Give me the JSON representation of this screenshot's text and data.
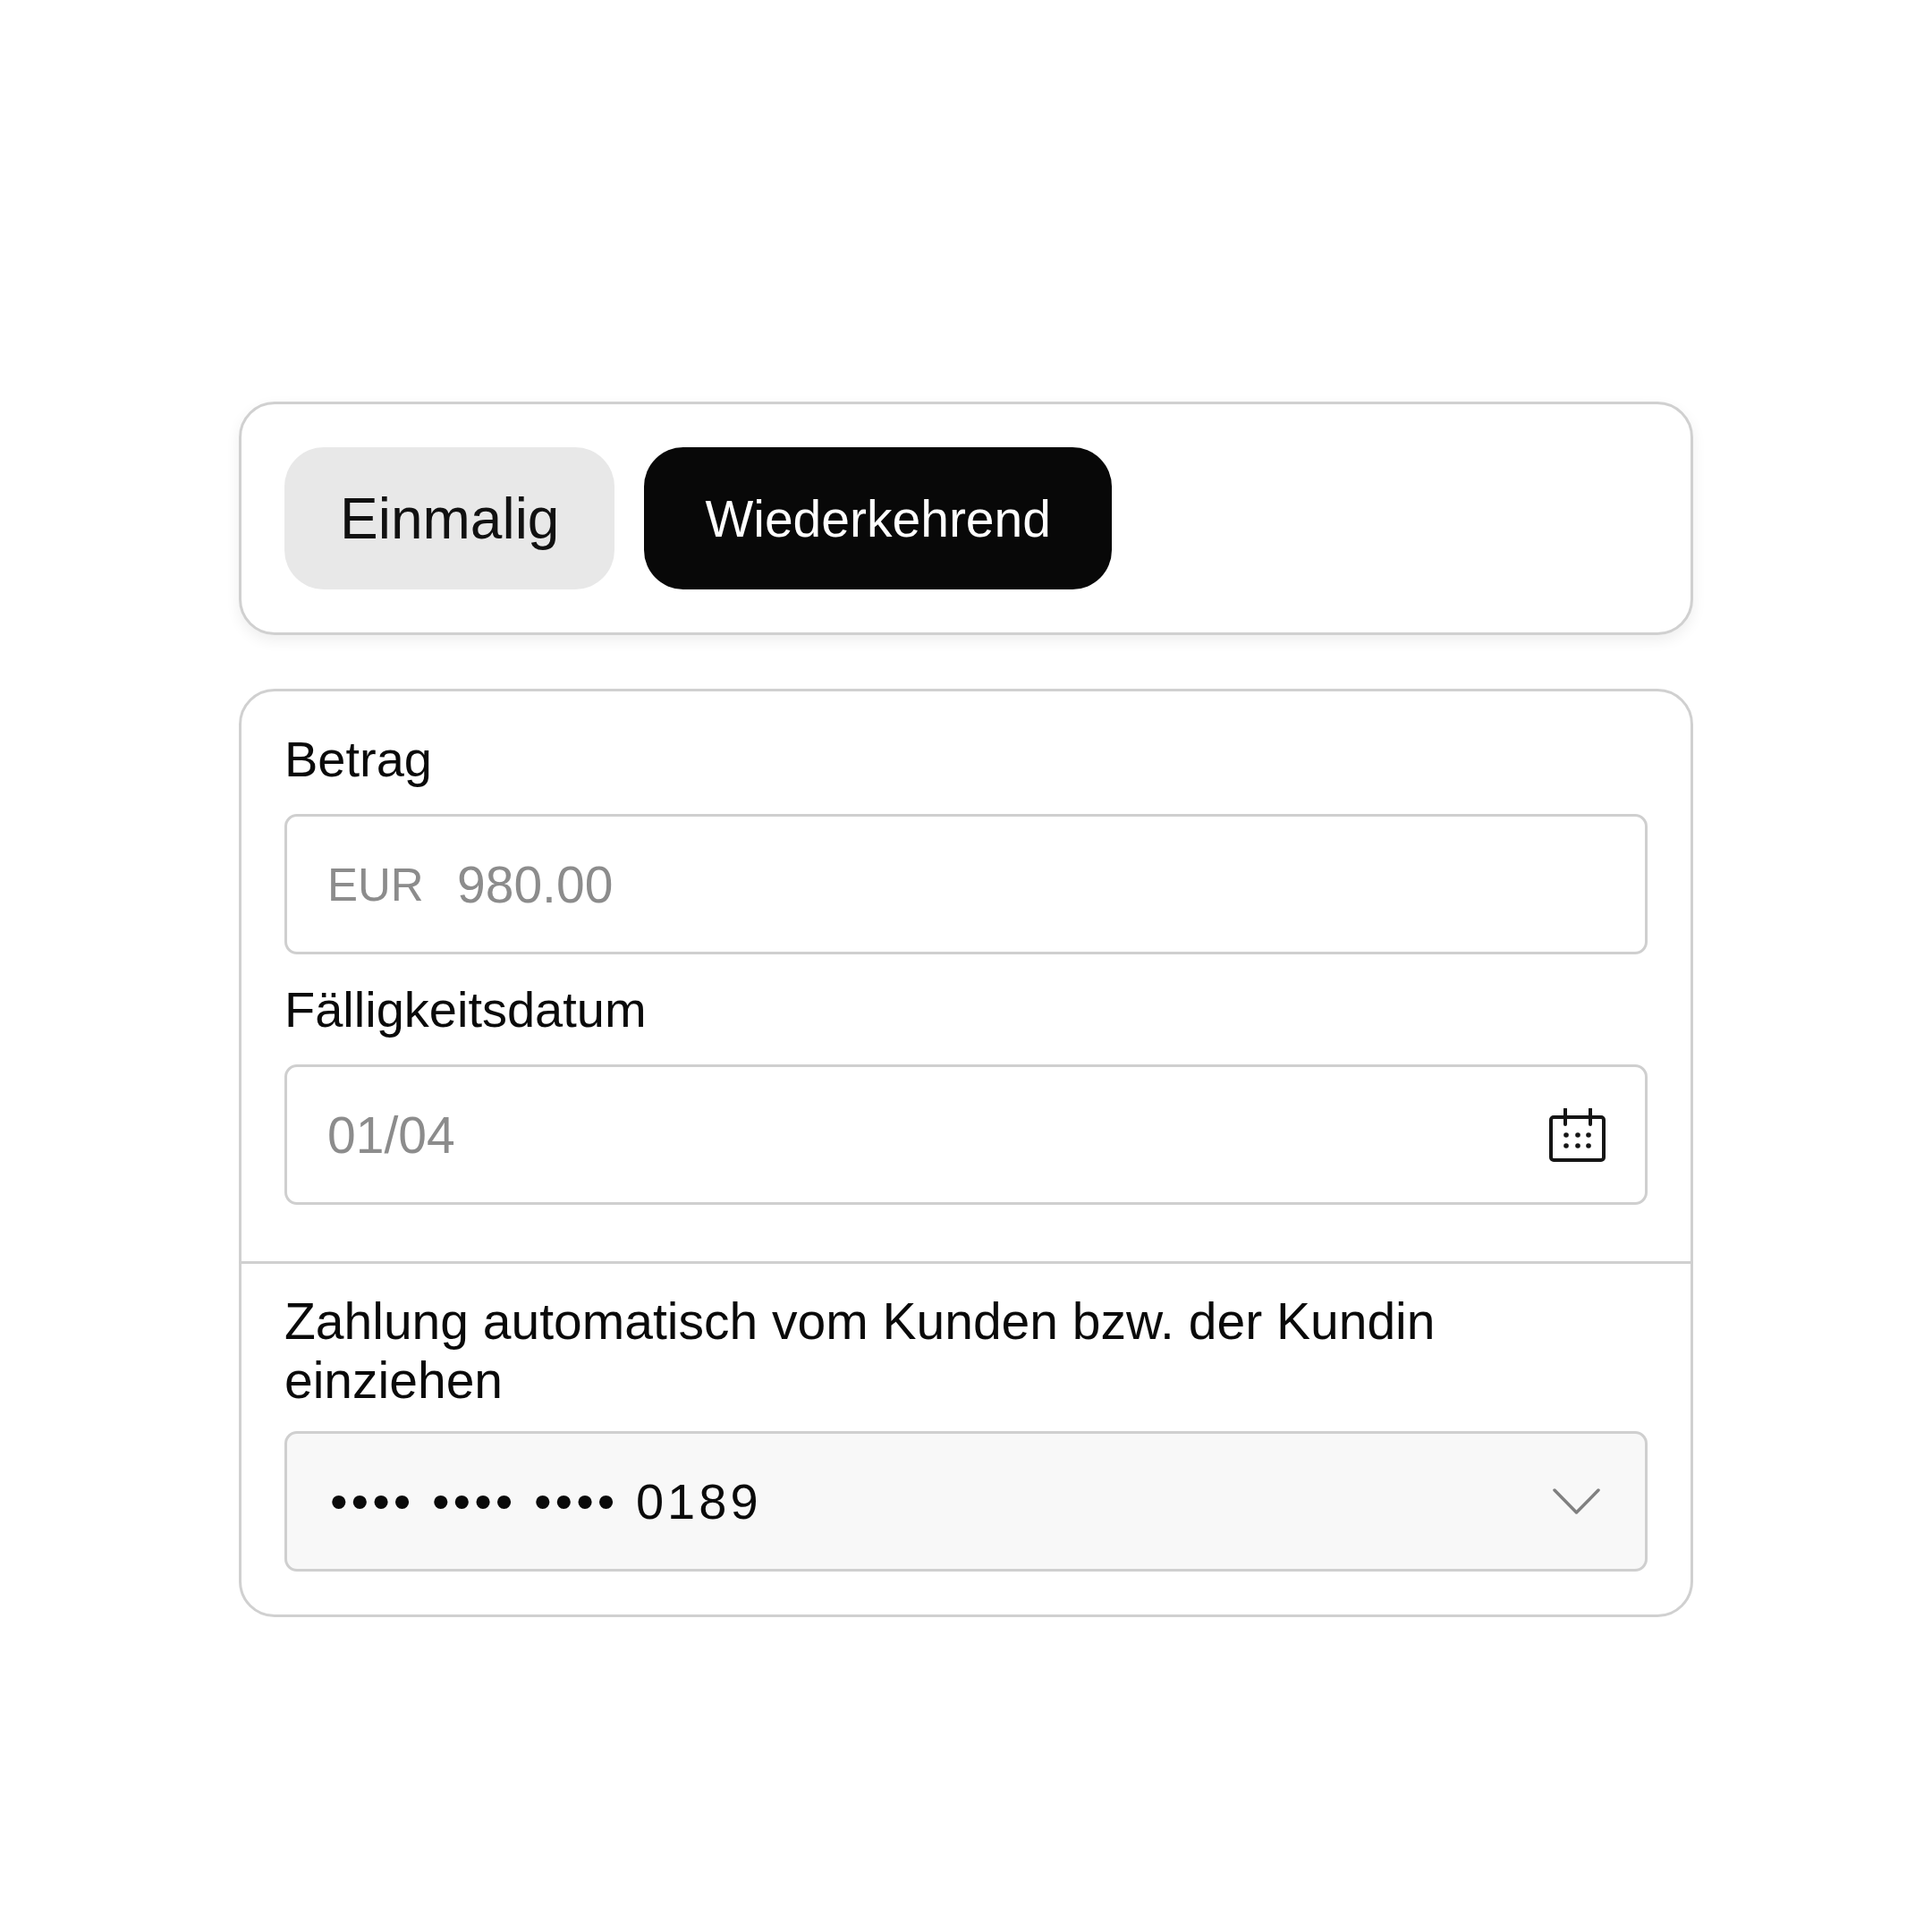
{
  "payment_type_tabs": [
    {
      "label": "Einmalig",
      "selected": false
    },
    {
      "label": "Wiederkehrend",
      "selected": true
    }
  ],
  "form": {
    "fields": [
      {
        "kind": "amount",
        "label": "Betrag",
        "prefix": "EUR",
        "placeholder": "980.00"
      },
      {
        "kind": "date",
        "label": "Fälligkeitsdatum",
        "placeholder": "01/04"
      }
    ],
    "direct_debit": {
      "label": "Zahlung automatisch vom Kunden bzw. der Kundin einziehen",
      "value": "•••• •••• •••• 0189"
    }
  }
}
